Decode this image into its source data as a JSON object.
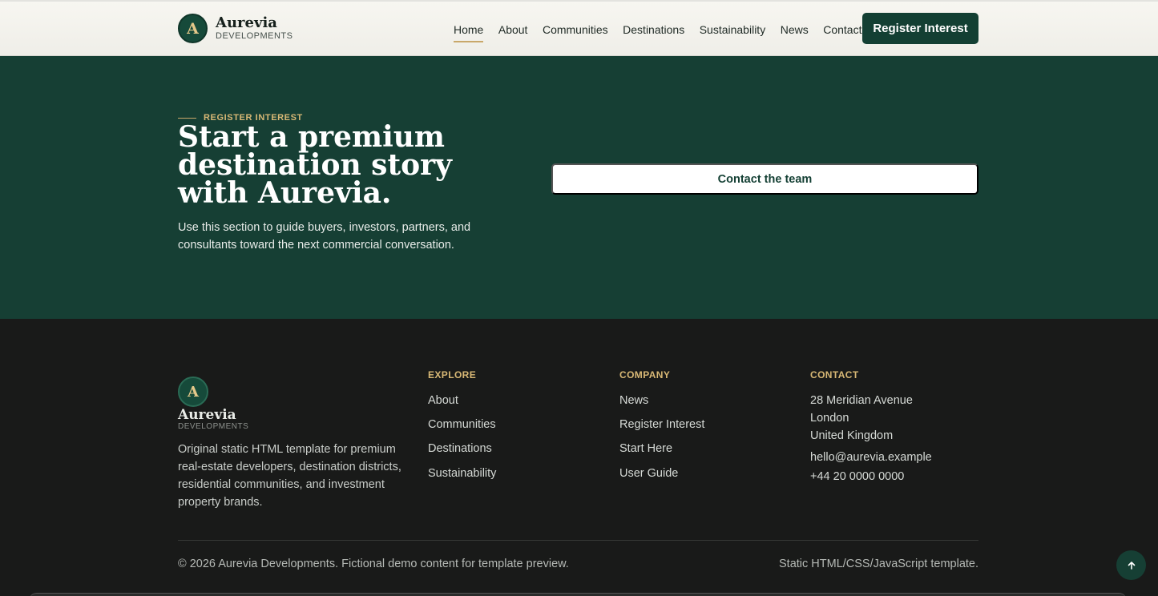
{
  "header": {
    "logo_letter": "A",
    "brand_name": "Aurevia",
    "brand_sub": "DEVELOPMENTS",
    "nav": [
      {
        "label": "Home",
        "active": true
      },
      {
        "label": "About"
      },
      {
        "label": "Communities"
      },
      {
        "label": "Destinations"
      },
      {
        "label": "Sustainability"
      },
      {
        "label": "News"
      },
      {
        "label": "Contact"
      }
    ],
    "register_label": "Register Interest"
  },
  "cta": {
    "eyebrow": "REGISTER INTEREST",
    "title": "Start a premium destination story with Aurevia.",
    "text": "Use this section to guide buyers, investors, partners, and consultants toward the next commercial conversation.",
    "button": "Contact the team"
  },
  "footer": {
    "logo_letter": "A",
    "brand_name": "Aurevia",
    "brand_sub": "DEVELOPMENTS",
    "description": "Original static HTML template for premium real-estate developers, destination districts, residential communities, and investment property brands.",
    "explore": {
      "heading": "EXPLORE",
      "links": [
        "About",
        "Communities",
        "Destinations",
        "Sustainability"
      ]
    },
    "company": {
      "heading": "COMPANY",
      "links": [
        "News",
        "Register Interest",
        "Start Here",
        "User Guide"
      ]
    },
    "contact": {
      "heading": "CONTACT",
      "address": [
        "28 Meridian Avenue",
        "London",
        "United Kingdom"
      ],
      "email": "hello@aurevia.example",
      "phone": "+44 20 0000 0000"
    },
    "copyright": "© 2026 Aurevia Developments. Fictional demo content for template preview.",
    "tech": "Static HTML/CSS/JavaScript template.",
    "back_to_top_icon": "arrow-up-icon"
  },
  "colors": {
    "primary": "#163f34",
    "accent": "#c9a86a",
    "footer_bg": "#191a19"
  }
}
